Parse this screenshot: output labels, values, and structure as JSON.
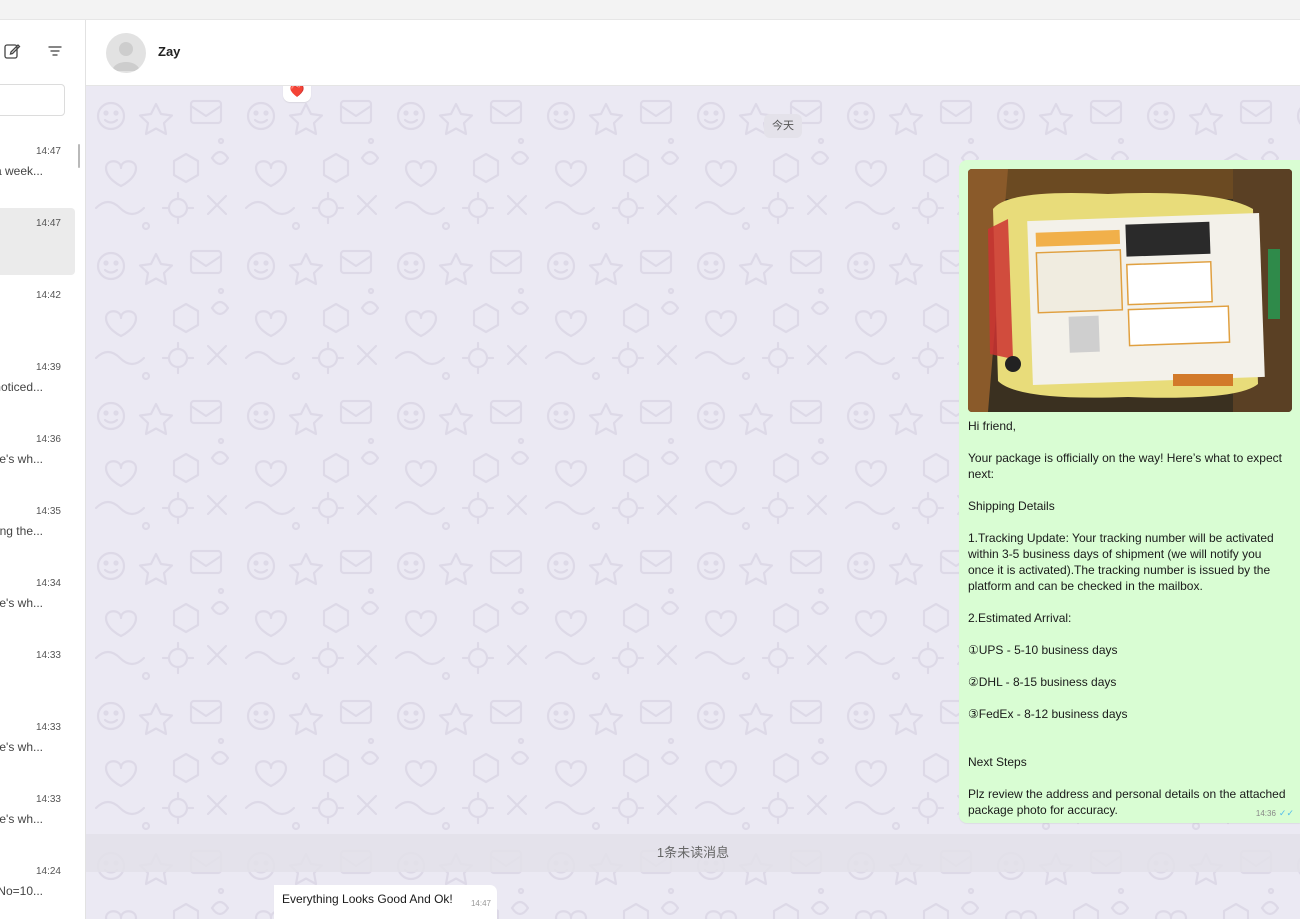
{
  "window": {
    "title": "Zay"
  },
  "sidebar": {
    "icons": [
      "compose-icon",
      "filter-icon"
    ],
    "search": {
      "placeholder": ""
    },
    "conversations": [
      {
        "time": "14:47",
        "preview": "a week...",
        "active": false
      },
      {
        "time": "14:47",
        "preview": "",
        "active": true
      },
      {
        "time": "14:42",
        "preview": "",
        "active": false
      },
      {
        "time": "14:39",
        "preview": "noticed...",
        "active": false
      },
      {
        "time": "14:36",
        "preview": "re's wh...",
        "active": false
      },
      {
        "time": "14:35",
        "preview": "ng the...",
        "active": false
      },
      {
        "time": "14:34",
        "preview": "re's wh...",
        "active": false
      },
      {
        "time": "14:33",
        "preview": "",
        "active": false
      },
      {
        "time": "14:33",
        "preview": "re's wh...",
        "active": false
      },
      {
        "time": "14:33",
        "preview": "re's wh...",
        "active": false
      },
      {
        "time": "14:24",
        "preview": "No=10...",
        "active": false
      }
    ]
  },
  "header": {
    "contact_name": "Zay"
  },
  "chat": {
    "reaction": "❤️",
    "date_chip": "今天",
    "outgoing": {
      "image_alt": "shipping-package-photo",
      "text": "Hi friend,\n\nYour package is officially on the way!  Here’s what to expect next:\n\nShipping Details\n\n1.Tracking Update: Your tracking number will be activated within 3-5 business days of shipment (we will notify you once it is activated).The tracking number is issued by the platform and can be checked in the mailbox.\n\n2.Estimated Arrival:\n\n①UPS - 5-10 business days\n\n②DHL - 8-15 business days\n\n③FedEx - 8-12 business days\n\n\nNext Steps\n\nPlz review the address and personal details on the attached package photo for accuracy.",
      "time": "14:36",
      "status": "✓✓"
    },
    "unread_banner": "1条未读消息",
    "incoming": {
      "text": "Everything Looks Good And Ok!",
      "time": "14:47"
    }
  },
  "colors": {
    "chat_bg": "#ebe9f3",
    "outgoing_bubble": "#d9fdd3",
    "incoming_bubble": "#ffffff",
    "read_ticks": "#53bdeb"
  }
}
